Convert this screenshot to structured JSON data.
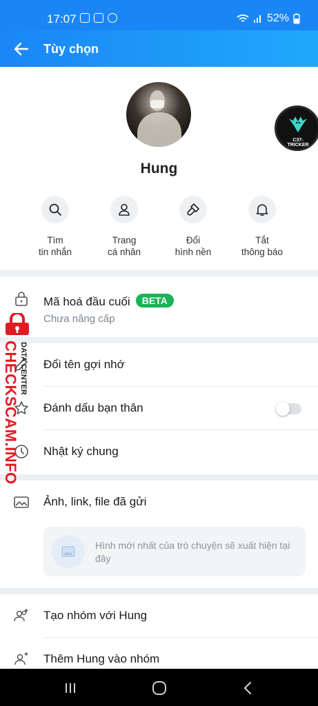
{
  "status_bar": {
    "time": "17:07",
    "battery": "52%"
  },
  "header": {
    "title": "Tùy chọn",
    "back_icon": "back-arrow-icon"
  },
  "profile": {
    "name": "Hung"
  },
  "floating_bubble": {
    "label": "C37-TRICKER"
  },
  "actions": [
    {
      "label": "Tìm\ntin nhắn",
      "icon": "search-icon"
    },
    {
      "label": "Trang\ncá nhân",
      "icon": "user-icon"
    },
    {
      "label": "Đổi\nhình nền",
      "icon": "paintbrush-icon"
    },
    {
      "label": "Tắt\nthông báo",
      "icon": "bell-icon"
    }
  ],
  "encryption": {
    "label": "Mã hoá đầu cuối",
    "badge": "BETA",
    "status": "Chưa nâng cấp"
  },
  "options": {
    "rename": "Đổi tên gợi nhớ",
    "best_friend": "Đánh dấu bạn thân",
    "best_friend_enabled": false,
    "diary": "Nhật ký chung"
  },
  "media": {
    "label": "Ảnh, link, file đã gửi",
    "empty_text": "Hình mới nhất của trò chuyện sẽ xuất hiện tại đây"
  },
  "group": {
    "create": "Tạo nhóm với Hung",
    "add": "Thêm Hung vào nhóm"
  },
  "watermark": {
    "site": "CHECKSCAM.INFO",
    "sub": "DATA CENTER"
  },
  "colors": {
    "header": "#1a86f5",
    "beta": "#18b354",
    "watermark": "#e21b22"
  }
}
